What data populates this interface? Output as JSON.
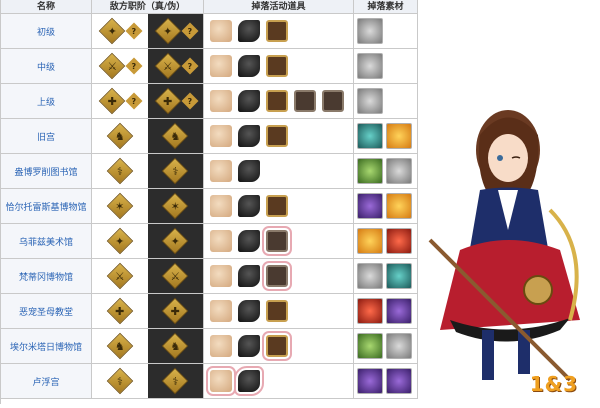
{
  "headers": {
    "name": "名称",
    "roles": "敌方职阶（真/伪）",
    "drops": "掉落活动道具",
    "mats": "掉落素材"
  },
  "rows": [
    {
      "name": "初级"
    },
    {
      "name": "中级"
    },
    {
      "name": "上级"
    },
    {
      "name": "旧宫"
    },
    {
      "name": "盎博罗削图书馆"
    },
    {
      "name": "恰尔托雷斯基博物馆"
    },
    {
      "name": "乌菲兹美术馆"
    },
    {
      "name": "梵蒂冈博物馆"
    },
    {
      "name": "恶宠圣母教堂"
    },
    {
      "name": "埃尔米塔日博物馆"
    },
    {
      "name": "卢浮宫"
    }
  ],
  "role_icons": [
    "caster-icon",
    "unknown-class-icon",
    "assassin-icon",
    "saber-icon",
    "rider-icon",
    "lancer-icon"
  ],
  "question_mark": "?",
  "logo": "1&3"
}
